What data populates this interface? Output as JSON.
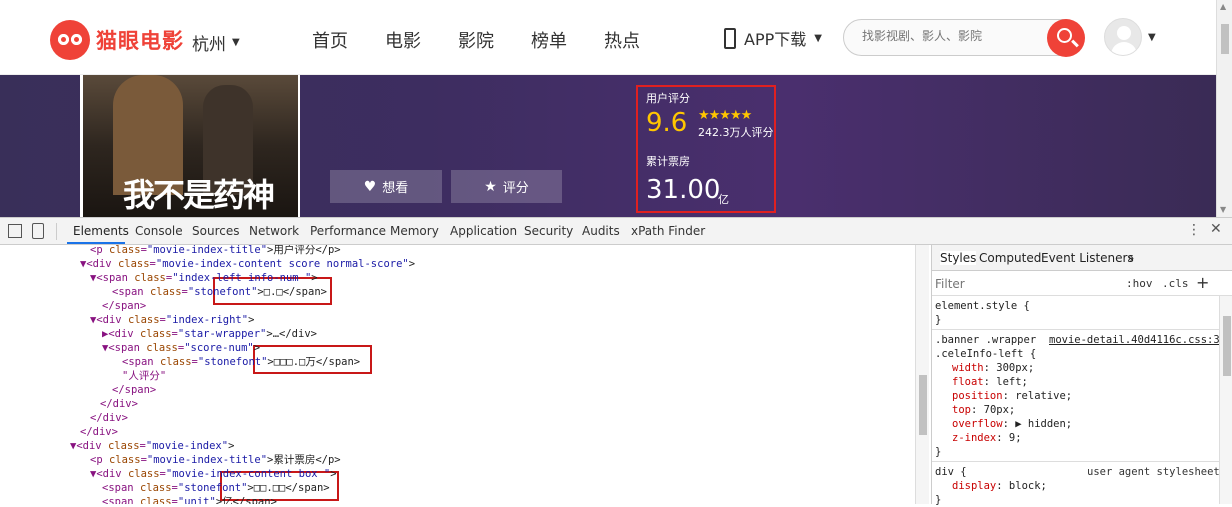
{
  "header": {
    "logo_text": "猫眼电影",
    "city": "杭州",
    "nav": [
      "首页",
      "电影",
      "影院",
      "榜单",
      "热点"
    ],
    "app_download": "APP下载",
    "search_placeholder": "找影视剧、影人、影院"
  },
  "banner": {
    "poster_title": "我不是药神",
    "want_label": "想看",
    "rate_label": "评分",
    "user_score_label": "用户评分",
    "score": "9.6",
    "stars": "★★★★★",
    "rating_count": "242.3万人评分",
    "box_office_label": "累计票房",
    "box_office": "31.00",
    "box_office_unit": "亿"
  },
  "devtools": {
    "tabs": [
      "Elements",
      "Console",
      "Sources",
      "Network",
      "Performance",
      "Memory",
      "Application",
      "Security",
      "Audits",
      "xPath Finder"
    ],
    "active_tab": "Elements",
    "elements_lines": [
      {
        "pre": "<p ",
        "an": "class",
        "av": "\"movie-index-title\"",
        "post": ">用户评分</p>"
      },
      {
        "pre": "▼<div ",
        "an": "class",
        "av": "\"movie-index-content score normal-score\"",
        "post": ">"
      },
      {
        "pre": "▼<span ",
        "an": "class",
        "av": "\"index-left info-num \"",
        "post": ">"
      },
      {
        "pre": "<span ",
        "an": "class",
        "av": "\"stonefont\"",
        "post": ">□.□</span>"
      },
      {
        "pre": "</span>",
        "an": "",
        "av": "",
        "post": ""
      },
      {
        "pre": "▼<div ",
        "an": "class",
        "av": "\"index-right\"",
        "post": ">"
      },
      {
        "pre": "▶<div ",
        "an": "class",
        "av": "\"star-wrapper\"",
        "post": ">…</div>"
      },
      {
        "pre": "▼<span ",
        "an": "class",
        "av": "\"score-num\"",
        "post": ">"
      },
      {
        "pre": "<span ",
        "an": "class",
        "av": "\"stonefont\"",
        "post": ">□□□.□万</span>"
      },
      {
        "pre": "\"人评分\"",
        "an": "",
        "av": "",
        "post": ""
      },
      {
        "pre": "</span>",
        "an": "",
        "av": "",
        "post": ""
      },
      {
        "pre": "</div>",
        "an": "",
        "av": "",
        "post": ""
      },
      {
        "pre": "</div>",
        "an": "",
        "av": "",
        "post": ""
      },
      {
        "pre": "</div>",
        "an": "",
        "av": "",
        "post": ""
      },
      {
        "pre": "▼<div ",
        "an": "class",
        "av": "\"movie-index\"",
        "post": ">"
      },
      {
        "pre": "<p ",
        "an": "class",
        "av": "\"movie-index-title\"",
        "post": ">累计票房</p>"
      },
      {
        "pre": "▼<div ",
        "an": "class",
        "av": "\"movie-index-content box \"",
        "post": ">"
      },
      {
        "pre": "<span ",
        "an": "class",
        "av": "\"stonefont\"",
        "post": ">□□.□□</span>"
      },
      {
        "pre": "<span ",
        "an": "class",
        "av": "\"unit\"",
        "post": ">亿</span>"
      }
    ],
    "styles_tabs": [
      "Styles",
      "Computed",
      "Event Listeners",
      "»"
    ],
    "filter_placeholder": "Filter",
    "hov": ":hov",
    "cls": ".cls",
    "plus": "+",
    "element_style": [
      "element.style {",
      "}"
    ],
    "rule1_selector": ".banner .wrapper",
    "rule1_selector2": ".celeInfo-left {",
    "rule1_link": "movie-detail.40d4116c.css:3",
    "rule1_props": [
      {
        "name": "width",
        "value": "300px;"
      },
      {
        "name": "float",
        "value": "left;"
      },
      {
        "name": "position",
        "value": "relative;"
      },
      {
        "name": "top",
        "value": "70px;"
      },
      {
        "name": "overflow",
        "value": "▶ hidden;"
      },
      {
        "name": "z-index",
        "value": "9;"
      }
    ],
    "rule_close": "}",
    "rule2_selector": "div {",
    "rule2_source": "user agent stylesheet",
    "rule2_props": [
      {
        "name": "display",
        "value": "block;"
      }
    ],
    "icons": {
      "more": "⋮",
      "close": "✕"
    }
  },
  "colors": {
    "brand": "#ef4238",
    "score": "#ffc600",
    "highlight": "#c81818"
  }
}
